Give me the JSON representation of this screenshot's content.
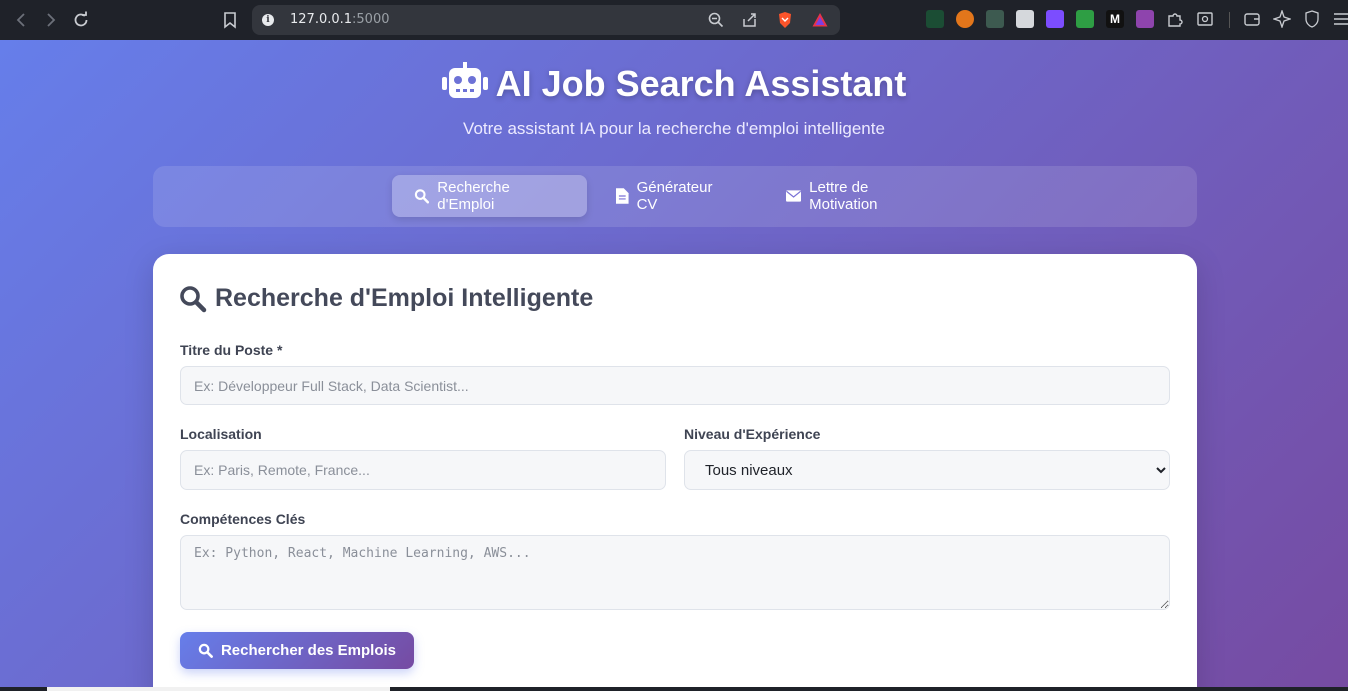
{
  "browser": {
    "url_host": "127.0.0.1",
    "url_port": ":5000"
  },
  "hero": {
    "title": "AI Job Search Assistant",
    "subtitle": "Votre assistant IA pour la recherche d'emploi intelligente"
  },
  "tabs": [
    {
      "label": "Recherche d'Emploi",
      "icon": "search-icon",
      "active": true
    },
    {
      "label": "Générateur CV",
      "icon": "file-icon",
      "active": false
    },
    {
      "label": "Lettre de Motivation",
      "icon": "envelope-icon",
      "active": false
    }
  ],
  "form": {
    "title": "Recherche d'Emploi Intelligente",
    "job_title_label": "Titre du Poste *",
    "job_title_placeholder": "Ex: Développeur Full Stack, Data Scientist...",
    "location_label": "Localisation",
    "location_placeholder": "Ex: Paris, Remote, France...",
    "experience_label": "Niveau d'Expérience",
    "experience_selected": "Tous niveaux",
    "skills_label": "Compétences Clés",
    "skills_placeholder": "Ex: Python, React, Machine Learning, AWS...",
    "submit_label": "Rechercher des Emplois"
  },
  "colors": {
    "gradient_start": "#667eea",
    "gradient_end": "#764ba2"
  }
}
